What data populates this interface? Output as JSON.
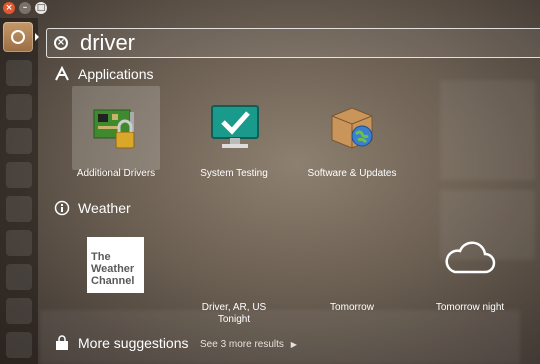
{
  "window_controls": {
    "close": "×",
    "minimize": "–",
    "maximize": "□"
  },
  "search": {
    "query": "driver",
    "clear_icon": "close-circle-icon"
  },
  "sections": {
    "applications": {
      "title": "Applications",
      "icon": "applications-lens-icon",
      "items": [
        {
          "label": "Additional Drivers",
          "icon": "circuit-board-lock-icon",
          "selected": true
        },
        {
          "label": "System Testing",
          "icon": "monitor-checkmark-icon",
          "selected": false
        },
        {
          "label": "Software & Updates",
          "icon": "package-globe-icon",
          "selected": false
        }
      ]
    },
    "weather": {
      "title": "Weather",
      "icon": "info-icon",
      "items": [
        {
          "label": "",
          "icon": "weather-channel-logo",
          "logo_text": "The\nWeather\nChannel"
        },
        {
          "label": "Driver, AR, US\nTonight",
          "icon": "night-weather-icon"
        },
        {
          "label": "Tomorrow",
          "icon": "weather-icon"
        },
        {
          "label": "Tomorrow night",
          "icon": "cloud-icon"
        }
      ]
    },
    "more_suggestions": {
      "title": "More suggestions",
      "icon": "shopping-bag-icon",
      "see_more": "See 3 more results"
    }
  },
  "colors": {
    "close_button": "#e2572b",
    "dash_button": "#b5844f",
    "selected_highlight": "rgba(255,255,255,0.18)"
  }
}
